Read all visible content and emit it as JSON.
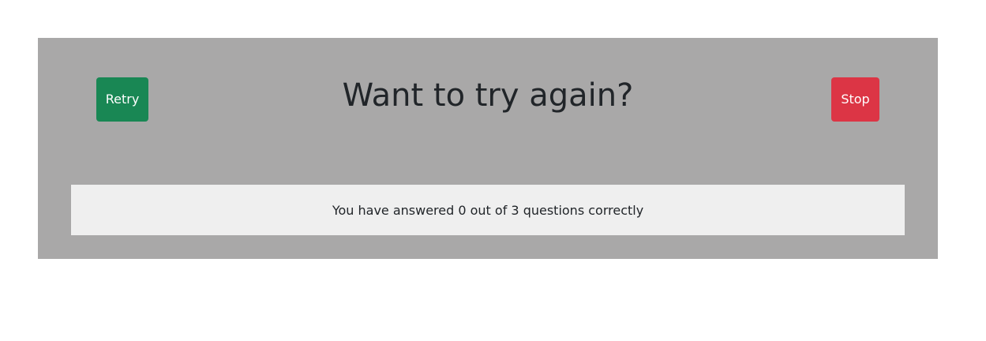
{
  "dialog": {
    "title": "Want to try again?",
    "retry_label": "Retry",
    "stop_label": "Stop",
    "result_text": "You have answered 0 out of 3 questions correctly"
  },
  "colors": {
    "panel_bg": "#a9a8a8",
    "retry_bg": "#198754",
    "stop_bg": "#dc3545",
    "result_bg": "#efefef"
  }
}
